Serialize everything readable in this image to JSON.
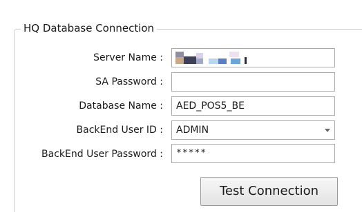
{
  "group": {
    "title": "HQ Database Connection"
  },
  "form": {
    "server_name": {
      "label": "Server Name :",
      "value": ""
    },
    "sa_password": {
      "label": "SA Password :",
      "value": ""
    },
    "database_name": {
      "label": "Database Name :",
      "value": "AED_POS5_BE"
    },
    "backend_user_id": {
      "label": "BackEnd User ID :",
      "value": "ADMIN",
      "icon": "chevron-down-icon"
    },
    "backend_user_password": {
      "label": "BackEnd User Password :",
      "value": "*****"
    }
  },
  "actions": {
    "test_connection_label": "Test Connection"
  },
  "colors": {
    "border": "#a9a9a9",
    "group_border": "#cfcfcf",
    "text": "#1a1a1a",
    "button_top": "#f7f7f7",
    "button_bottom": "#e3e3e3"
  }
}
